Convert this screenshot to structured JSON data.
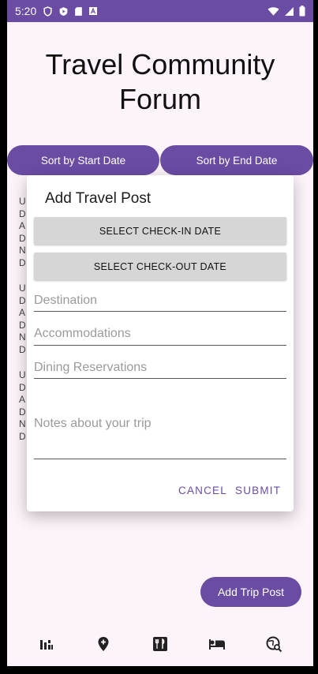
{
  "status_bar": {
    "time": "5:20"
  },
  "page": {
    "title": "Travel Community Forum"
  },
  "sort": {
    "start_label": "Sort by Start Date",
    "end_label": "Sort by End Date"
  },
  "background_posts": [
    [
      "U",
      "D",
      "A",
      "D",
      "N",
      "D"
    ],
    [
      "U",
      "D",
      "A",
      "D",
      "N",
      "D"
    ],
    [
      "U",
      "D",
      "A",
      "D",
      "N",
      "D"
    ]
  ],
  "dialog": {
    "title": "Add Travel Post",
    "checkin_label": "SELECT CHECK-IN DATE",
    "checkout_label": "SELECT CHECK-OUT DATE",
    "destination_placeholder": "Destination",
    "accommodations_placeholder": "Accommodations",
    "dining_placeholder": "Dining Reservations",
    "notes_placeholder": "Notes about your trip",
    "cancel_label": "CANCEL",
    "submit_label": "SUBMIT"
  },
  "fab": {
    "label": "Add Trip Post"
  },
  "bottom_nav": [
    "leaderboard-icon",
    "add-location-icon",
    "restaurant-menu-icon",
    "hotel-bed-icon",
    "travel-explore-icon"
  ],
  "colors": {
    "primary": "#6a4ca3",
    "background": "#fdf4fb"
  }
}
